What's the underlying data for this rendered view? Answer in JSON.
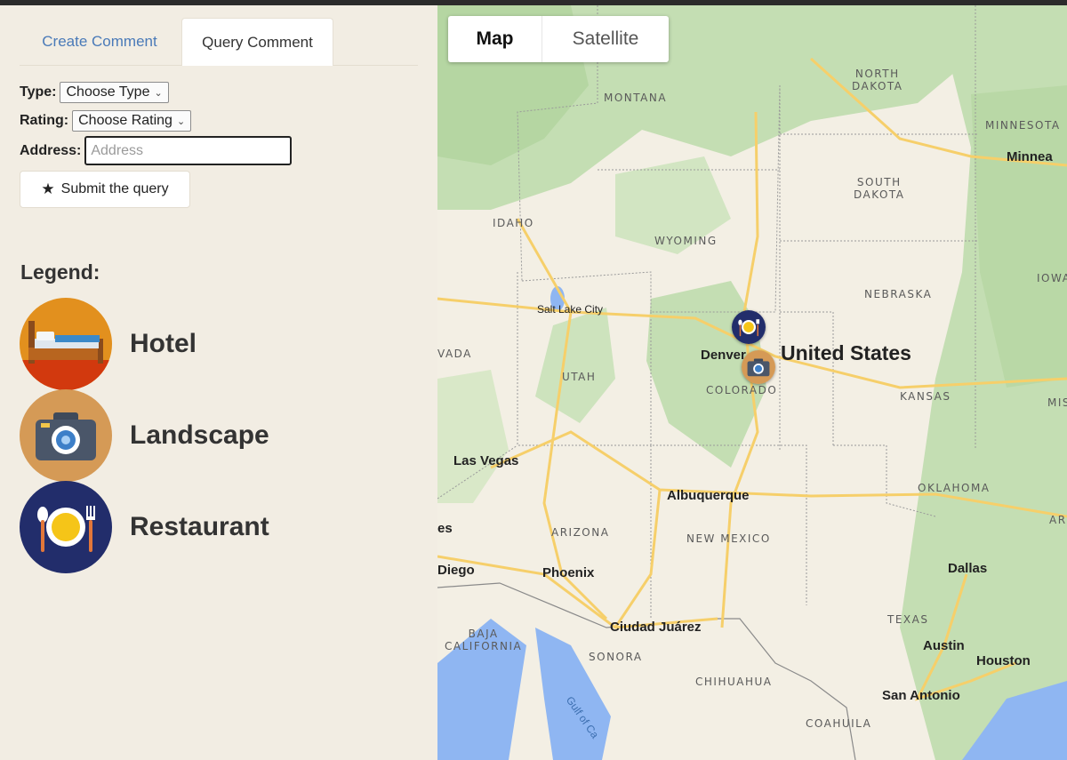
{
  "tabs": {
    "create": "Create Comment",
    "query": "Query Comment"
  },
  "form": {
    "type_label": "Type:",
    "type_value": "Choose Type",
    "rating_label": "Rating:",
    "rating_value": "Choose Rating",
    "address_label": "Address:",
    "address_placeholder": "Address",
    "address_value": "",
    "submit_label": "Submit the query"
  },
  "legend": {
    "title": "Legend:",
    "items": [
      {
        "label": "Hotel",
        "icon": "hotel-bed-icon"
      },
      {
        "label": "Landscape",
        "icon": "camera-icon"
      },
      {
        "label": "Restaurant",
        "icon": "plate-cutlery-icon"
      }
    ]
  },
  "map": {
    "type_buttons": [
      "Map",
      "Satellite"
    ],
    "selected_type": "Map",
    "country_label": "United States",
    "states": [
      "MONTANA",
      "NORTH\nDAKOTA",
      "MINNESOTA",
      "SOUTH\nDAKOTA",
      "IDAHO",
      "WYOMING",
      "NEBRASKA",
      "IOWA",
      "VADA",
      "UTAH",
      "COLORADO",
      "KANSAS",
      "MIS",
      "ARIZONA",
      "NEW MEXICO",
      "OKLAHOMA",
      "AR",
      "TEXAS",
      "BAJA\nCALIFORNIA",
      "SONORA",
      "CHIHUAHUA",
      "COAHUILA"
    ],
    "cities": [
      "Minnea",
      "Salt Lake City",
      "Denver",
      "Las Vegas",
      "Albuquerque",
      "es",
      "Diego",
      "Phoenix",
      "Dallas",
      "Ciudad Juárez",
      "Austin",
      "Houston",
      "San Antonio"
    ],
    "water": "Gulf of Ca",
    "colors": {
      "land": "#f3efe4",
      "green": "#c4deb3",
      "water": "#8fb6f2",
      "road": "#f6cf6a"
    }
  }
}
